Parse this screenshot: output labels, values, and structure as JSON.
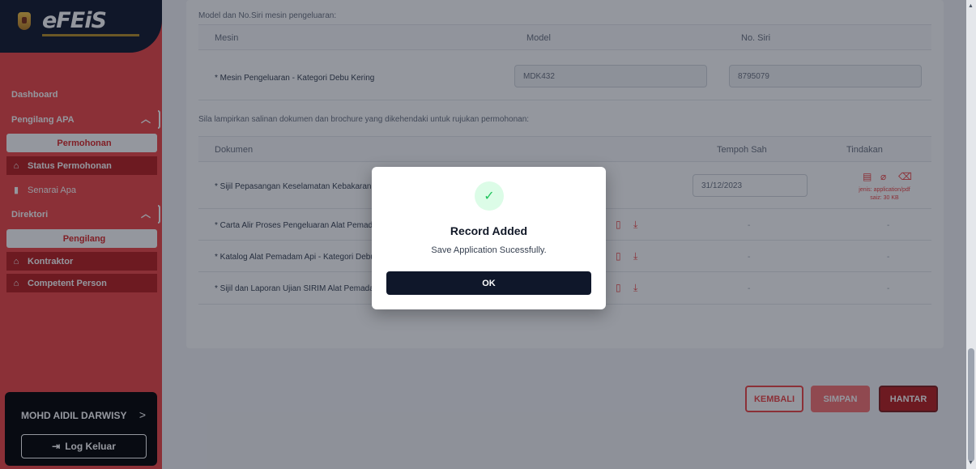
{
  "app": {
    "logo": "eFEiS"
  },
  "sidebar": {
    "dashboard": "Dashboard",
    "group1": {
      "label": "Pengilang APA",
      "chevron": "^"
    },
    "permohonan": "Permohonan",
    "status_permohonan": "Status Permohonan",
    "senarai_apa": "Senarai Apa",
    "group2": {
      "label": "Direktori",
      "chevron": "^"
    },
    "pengilang": "Pengilang",
    "kontraktor": "Kontraktor",
    "competent_person": "Competent Person",
    "user_name": "MOHD AIDIL DARWISY",
    "user_chevron": ">",
    "logout": "Log Keluar"
  },
  "main": {
    "section1_label": "Model dan No.Siri mesin pengeluaran:",
    "mesin_table": {
      "headers": [
        "Mesin",
        "Model",
        "No. Siri"
      ],
      "rows": [
        {
          "mesin": "* Mesin Pengeluaran - Kategori Debu Kering",
          "model": "MDK432",
          "no_siri": "8795079"
        }
      ]
    },
    "section2_label": "Sila lampirkan salinan dokumen dan brochure yang dikehendaki untuk rujukan permohonan:",
    "doc_table": {
      "headers": [
        "Dokumen",
        "Tempoh Sah",
        "Tindakan"
      ],
      "rows": [
        {
          "dokumen": "* Sijil Pepasangan Keselamatan Kebakaran",
          "tempoh": "31/12/2023",
          "jenis": "jenis: application/pdf",
          "saiz": "saiz: 30 KB"
        },
        {
          "dokumen": "* Carta Alir Proses Pengeluaran Alat Pemadam Api",
          "tempoh": "-",
          "tindakan": "-"
        },
        {
          "dokumen": "* Katalog Alat Pemadam Api - Kategori Debu Kering",
          "tempoh": "-",
          "tindakan": "-"
        },
        {
          "dokumen": "* Sijil dan Laporan Ujian SIRIM Alat Pemadam Api",
          "tempoh": "-",
          "tindakan": "-"
        }
      ]
    },
    "buttons": {
      "back": "KEMBALI",
      "save": "SIMPAN",
      "submit": "HANTAR"
    }
  },
  "modal": {
    "icon": "check-icon",
    "title": "Record Added",
    "message": "Save Application Sucessfully.",
    "ok": "OK"
  },
  "colors": {
    "accent": "#ef4444",
    "dark": "#0f172a",
    "success": "#22c55e"
  }
}
